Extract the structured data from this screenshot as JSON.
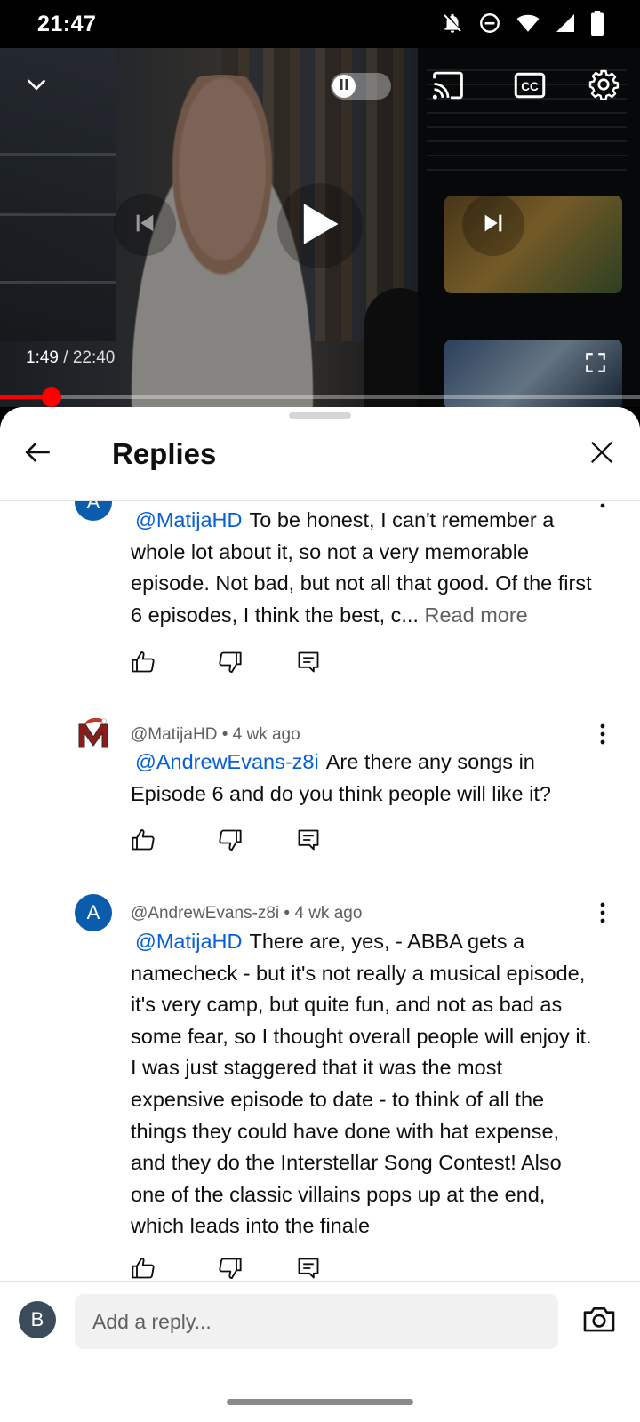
{
  "status_bar": {
    "time": "21:47",
    "icons": [
      "notifications-off-icon",
      "do-not-disturb-icon",
      "wifi-icon",
      "signal-icon",
      "battery-icon"
    ]
  },
  "player": {
    "current_time": "1:49",
    "separator": " / ",
    "duration": "22:40",
    "progress": 0.08,
    "controls": [
      "collapse",
      "pause-autoplay-toggle",
      "cast",
      "captions",
      "settings",
      "previous",
      "play",
      "next",
      "fullscreen"
    ],
    "accent_color": "#ff0000"
  },
  "sheet": {
    "title": "Replies"
  },
  "replies": [
    {
      "avatar_letter": "A",
      "mention": "@MatijaHD",
      "text": "To be honest, I can't remember a whole lot about it, so not a very memorable episode. Not bad, but not all that good. Of the first 6 episodes, I think the best, c...",
      "read_more": " Read more"
    },
    {
      "author": "@MatijaHD",
      "meta_sep": " • ",
      "time": "4 wk ago",
      "mention": "@AndrewEvans-z8i",
      "text": "Are there any songs in Episode 6 and do you think people will like it?"
    },
    {
      "avatar_letter": "A",
      "author": "@AndrewEvans-z8i",
      "meta_sep": " • ",
      "time": "4 wk ago",
      "mention": "@MatijaHD",
      "text": "There are, yes, - ABBA gets a namecheck - but it's not really a musical episode, it's very camp, but quite fun, and not as bad as some fear, so I thought overall people will enjoy it. I was just staggered that it was the most expensive episode to date - to think of all the things they could have done with hat expense, and they do the Interstellar Song Contest! Also one of the classic villains pops up at the end, which leads into the finale"
    }
  ],
  "composer": {
    "user_avatar_letter": "B",
    "placeholder": "Add a reply..."
  },
  "colors": {
    "link": "#065fd4",
    "avatar_a": "#0b5cad"
  }
}
